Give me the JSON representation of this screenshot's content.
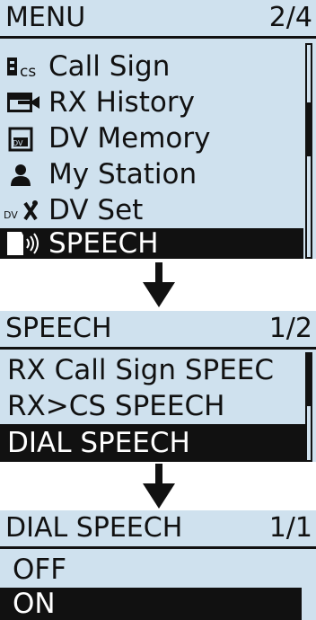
{
  "screen1": {
    "title": "MENU",
    "page": "2/4",
    "items": [
      {
        "label": "Call Sign",
        "icon": "callsign-icon",
        "icon_text": "cs"
      },
      {
        "label": "RX History",
        "icon": "rx-history-icon"
      },
      {
        "label": "DV Memory",
        "icon": "dv-memory-icon",
        "icon_text": "DV"
      },
      {
        "label": "My Station",
        "icon": "person-icon"
      },
      {
        "label": "DV Set",
        "icon": "dv-set-icon",
        "icon_text": "DV"
      },
      {
        "label": "SPEECH",
        "icon": "speech-icon",
        "selected": true
      }
    ]
  },
  "screen2": {
    "title": "SPEECH",
    "page": "1/2",
    "items": [
      {
        "label": "RX Call Sign SPEEC"
      },
      {
        "label": "RX>CS SPEECH"
      },
      {
        "label": "DIAL SPEECH",
        "selected": true
      }
    ]
  },
  "screen3": {
    "title": "DIAL SPEECH",
    "page": "1/1",
    "items": [
      {
        "label": "OFF"
      },
      {
        "label": "ON",
        "selected": true
      }
    ]
  },
  "colors": {
    "lcd_background": "#cfe1ee",
    "text": "#111111",
    "highlight": "#111111",
    "highlight_text": "#ffffff"
  }
}
